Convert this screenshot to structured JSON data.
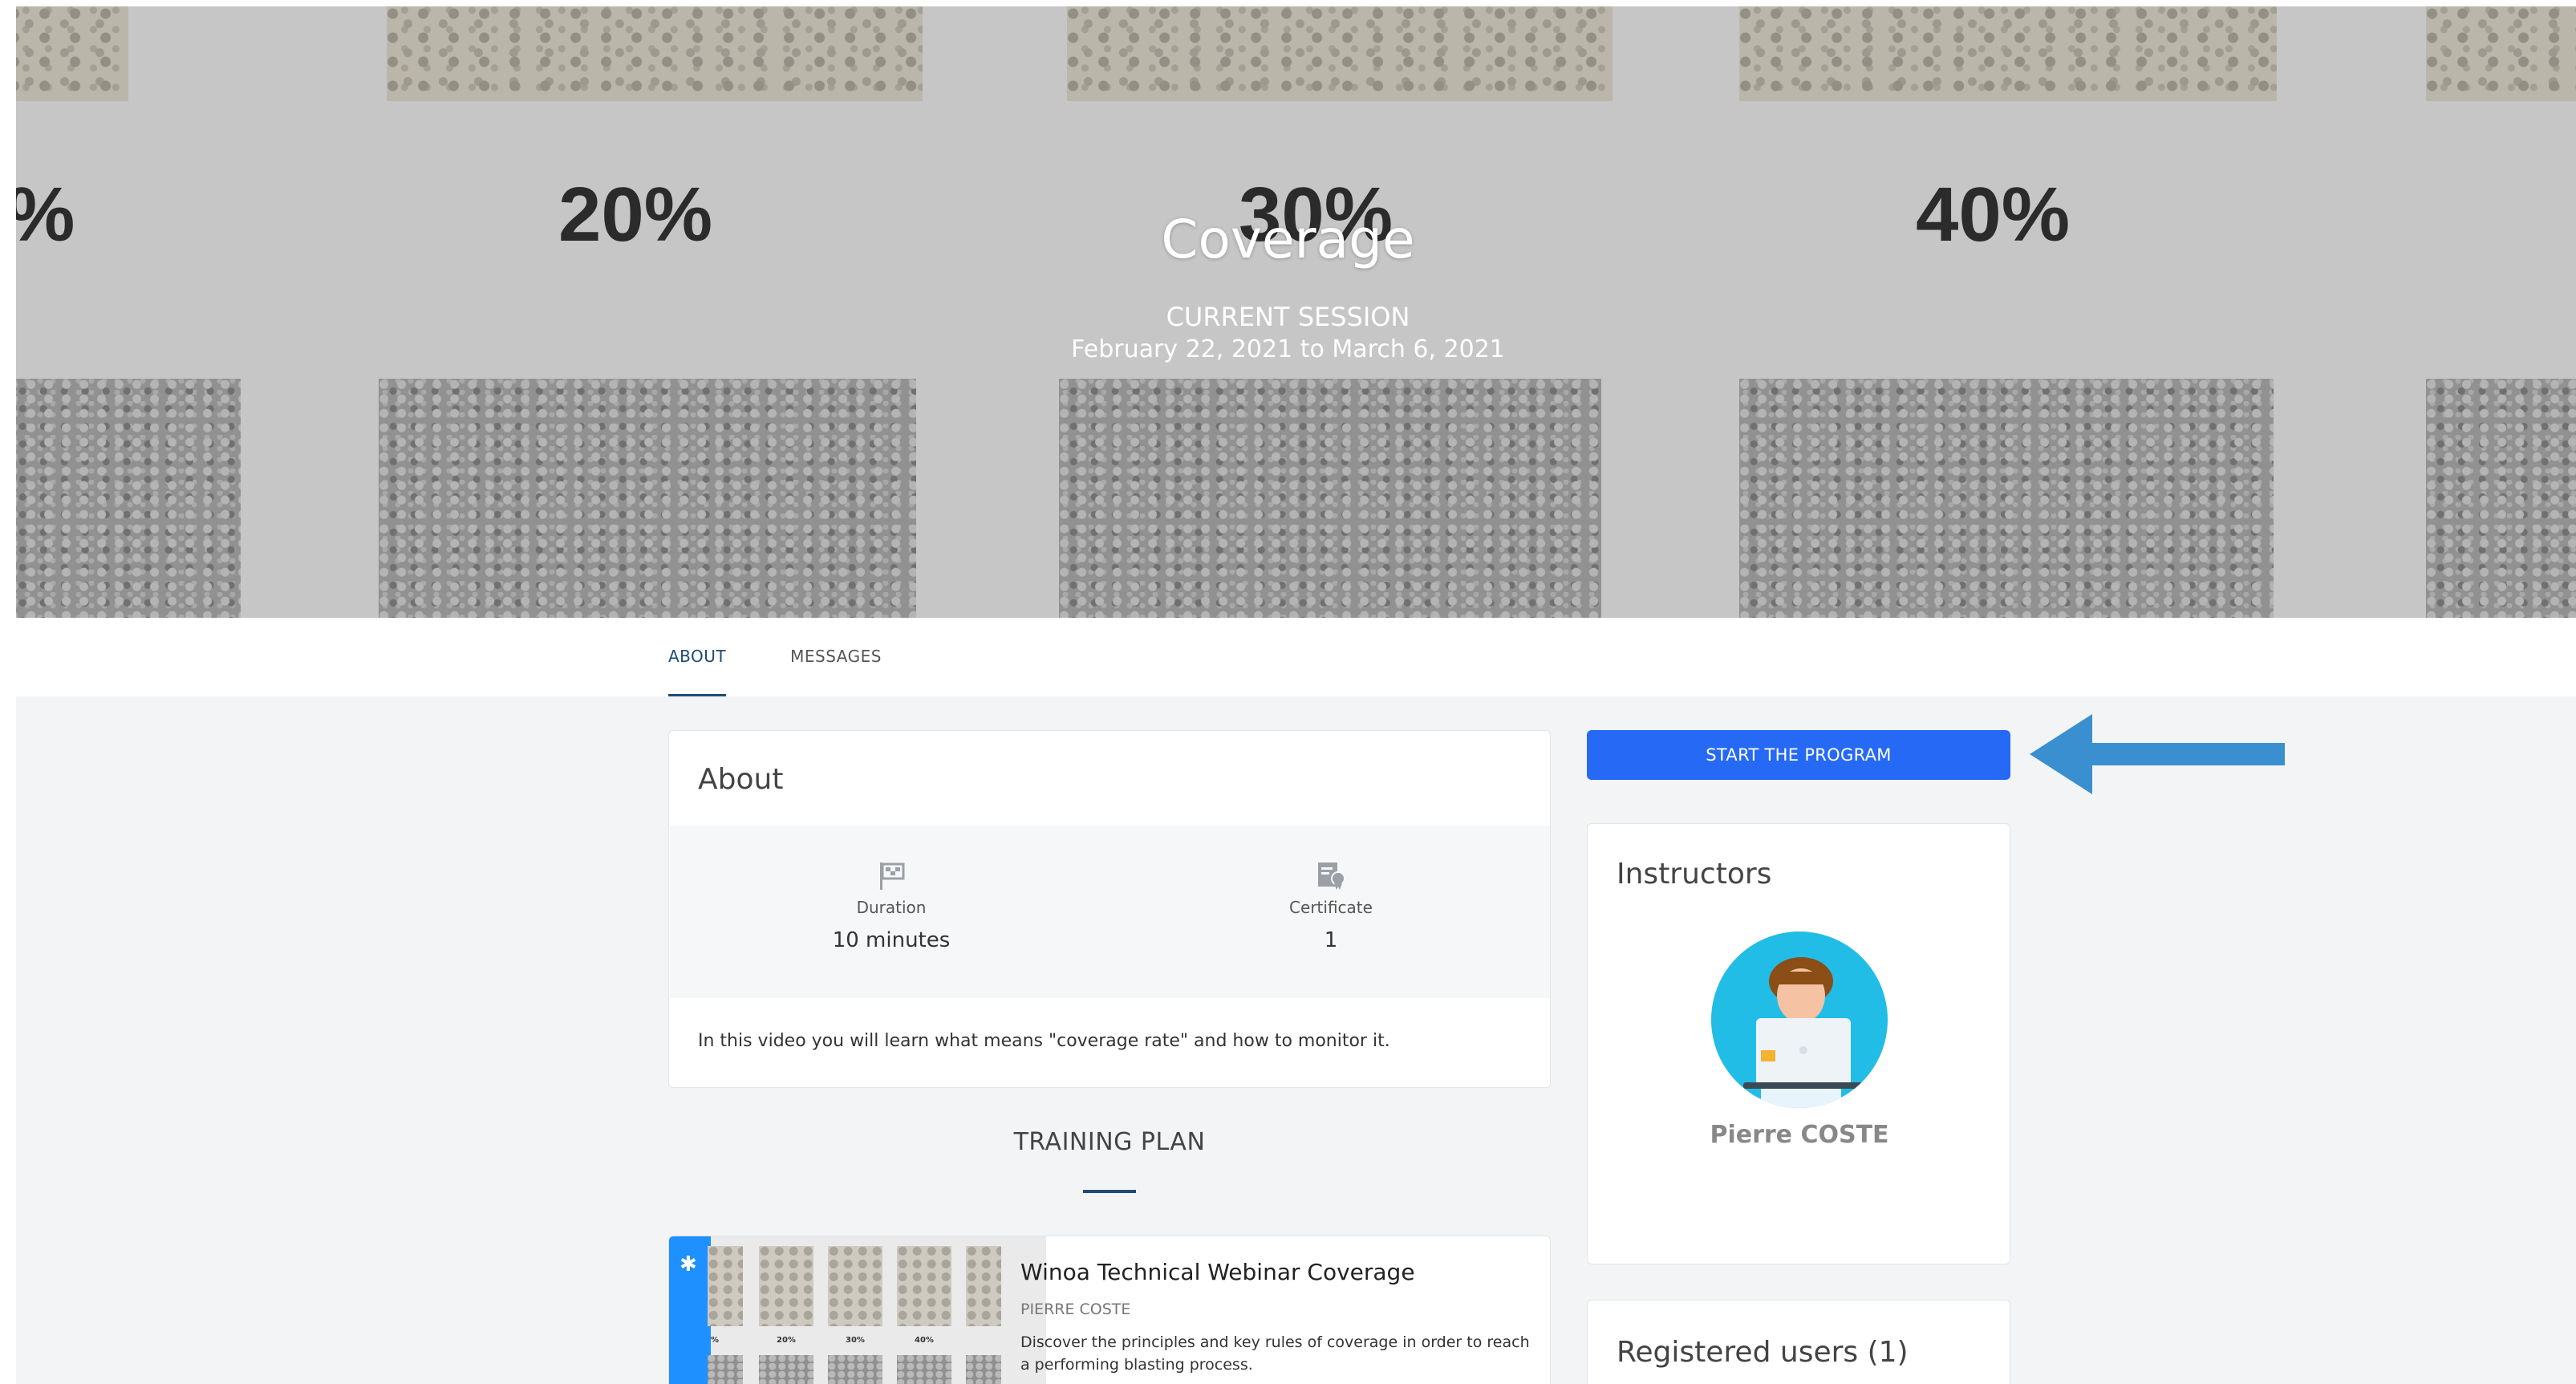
{
  "hero": {
    "percent_labels": [
      "%",
      "20%",
      "30%",
      "40%"
    ],
    "title": "Coverage",
    "session_label": "CURRENT SESSION",
    "session_dates": "February 22, 2021 to March 6, 2021"
  },
  "tabs": [
    {
      "label": "ABOUT",
      "active": true
    },
    {
      "label": "MESSAGES",
      "active": false
    }
  ],
  "about": {
    "title": "About",
    "duration_label": "Duration",
    "duration_value": "10 minutes",
    "duration_icon": "flag-icon",
    "certificate_label": "Certificate",
    "certificate_value": "1",
    "certificate_icon": "certificate-icon",
    "description": "In this video you will learn what means \"coverage rate\" and how to monitor it."
  },
  "training_plan": {
    "title": "TRAINING PLAN",
    "modules": [
      {
        "title": "Winoa Technical Webinar Coverage",
        "author": "PIERRE COSTE",
        "description": "Discover the principles and key rules of coverage in order to reach a performing blasting process.",
        "icon": "puzzle-icon"
      }
    ]
  },
  "sidebar": {
    "start_button": "START THE PROGRAM",
    "instructors_title": "Instructors",
    "instructor_name": "Pierre COSTE",
    "registered_title": "Registered users  (1)"
  },
  "colors": {
    "primary_button": "#2569f5",
    "arrow": "#3a8fd0",
    "active_tab": "#1f4b77",
    "module_stripe": "#1e90ff",
    "avatar_bg": "#22bde6"
  }
}
